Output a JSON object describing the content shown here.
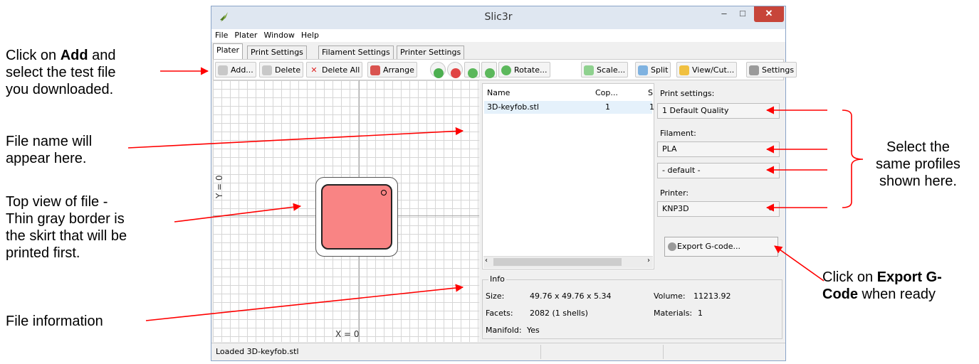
{
  "callouts": {
    "add": [
      "Click on ",
      "Add",
      " and",
      "select the test file",
      "you downloaded."
    ],
    "filename": [
      "File name will",
      "appear here."
    ],
    "topview": [
      "Top view of file -",
      "Thin gray border is",
      "the skirt that will be",
      "printed first."
    ],
    "fileinfo": "File information",
    "profiles": [
      "Select the",
      "same profiles",
      "shown here."
    ],
    "export": [
      "Click on ",
      "Export G-",
      "Code",
      " when ready"
    ]
  },
  "window": {
    "title": "Slic3r",
    "controls": {
      "minimize": "–",
      "maximize": "□",
      "close": "✕"
    }
  },
  "menu": [
    "File",
    "Plater",
    "Window",
    "Help"
  ],
  "tabs": [
    "Plater",
    "Print Settings",
    "Filament Settings",
    "Printer Settings"
  ],
  "toolbar": {
    "add": "Add...",
    "delete": "Delete",
    "delete_all": "Delete All",
    "arrange": "Arrange",
    "rotate": "Rotate...",
    "scale": "Scale...",
    "split": "Split",
    "view_cut": "View/Cut...",
    "settings": "Settings"
  },
  "plater": {
    "x_label": "X = 0",
    "y_label": "Y = 0"
  },
  "object_list": {
    "columns": [
      "Name",
      "Cop...",
      "S"
    ],
    "rows": [
      {
        "name": "3D-keyfob.stl",
        "copies": "1",
        "scale": "1"
      }
    ]
  },
  "settings": {
    "print_label": "Print settings:",
    "print_value": "1 Default Quality",
    "filament_label": "Filament:",
    "filament_value": "PLA",
    "filament2_value": "- default -",
    "printer_label": "Printer:",
    "printer_value": "KNP3D",
    "export_button": "Export G-code..."
  },
  "info": {
    "legend": "Info",
    "size_label": "Size:",
    "size_value": "49.76 x 49.76 x 5.34",
    "facets_label": "Facets:",
    "facets_value": "2082 (1 shells)",
    "manifold_label": "Manifold:",
    "manifold_value": "Yes",
    "volume_label": "Volume:",
    "volume_value": "11213.92",
    "materials_label": "Materials:",
    "materials_value": "1"
  },
  "status": "Loaded 3D-keyfob.stl",
  "colors": {
    "arrow": "#ff0000",
    "part_fill": "#f98484",
    "close_button": "#c7453a"
  }
}
